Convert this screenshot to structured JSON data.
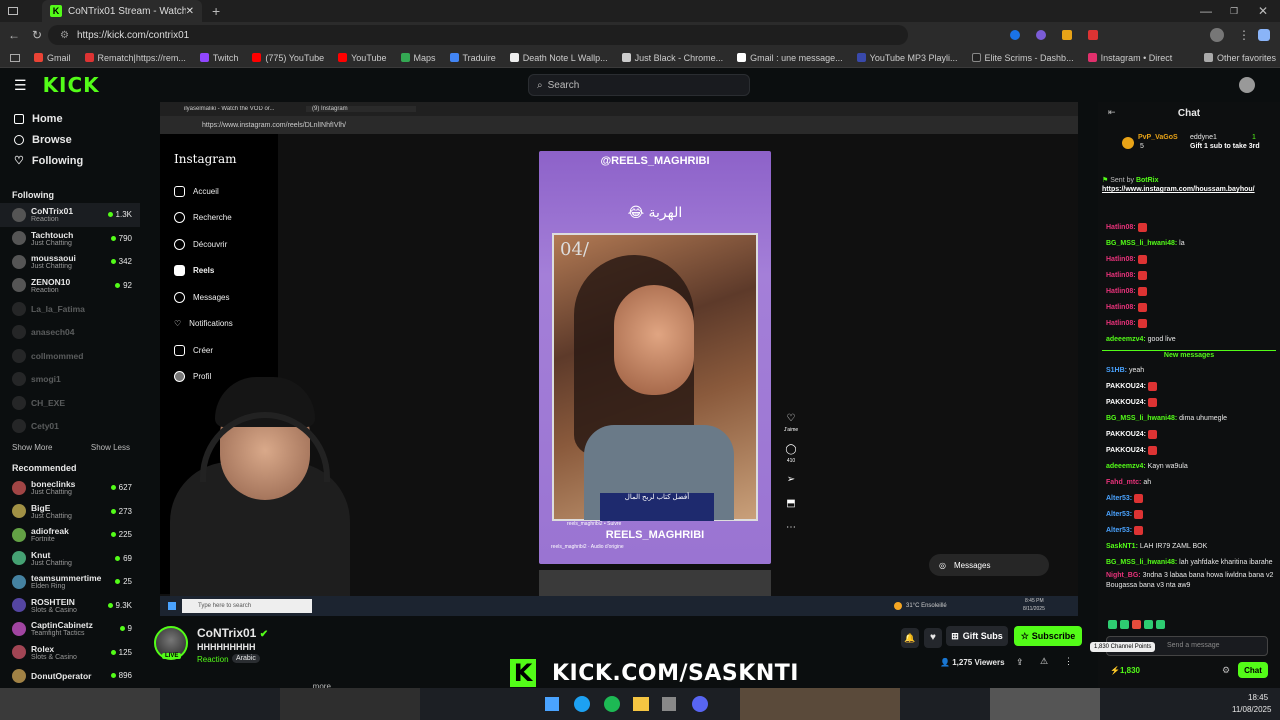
{
  "browser": {
    "tab_title": "CoNTrix01 Stream - Watch l...",
    "url": "https://kick.com/contrix01",
    "bookmarks": [
      "Gmail",
      "Rematch|https://rem...",
      "Twitch",
      "(775) YouTube",
      "YouTube",
      "Maps",
      "Traduire",
      "Death Note L Wallp...",
      "Just Black - Chrome...",
      "Gmail : une message...",
      "YouTube MP3 Playli...",
      "Elite Scrims - Dashb...",
      "Instagram • Direct"
    ],
    "other_favorites": "Other favorites"
  },
  "kick": {
    "logo": "KICK",
    "search_placeholder": "Search"
  },
  "sidebar": {
    "nav": [
      {
        "label": "Home",
        "icon": "home-icon"
      },
      {
        "label": "Browse",
        "icon": "browse-icon"
      },
      {
        "label": "Following",
        "icon": "heart-icon"
      }
    ],
    "following_title": "Following",
    "following": [
      {
        "name": "CoNTrix01",
        "cat": "Reaction",
        "viewers": "1.3K",
        "live": true
      },
      {
        "name": "Tachtouch",
        "cat": "Just Chatting",
        "viewers": "790",
        "live": true
      },
      {
        "name": "moussaoui",
        "cat": "Just Chatting",
        "viewers": "342",
        "live": true
      },
      {
        "name": "ZENON10",
        "cat": "Reaction",
        "viewers": "92",
        "live": true
      },
      {
        "name": "La_la_Fatima",
        "cat": "",
        "viewers": "",
        "live": false
      },
      {
        "name": "anasech04",
        "cat": "",
        "viewers": "",
        "live": false
      },
      {
        "name": "collmommed",
        "cat": "",
        "viewers": "",
        "live": false
      },
      {
        "name": "smogi1",
        "cat": "",
        "viewers": "",
        "live": false
      },
      {
        "name": "CH_EXE",
        "cat": "",
        "viewers": "",
        "live": false
      },
      {
        "name": "Cety01",
        "cat": "",
        "viewers": "",
        "live": false
      }
    ],
    "show_more": "Show More",
    "show_less": "Show Less",
    "recommended_title": "Recommended",
    "recommended": [
      {
        "name": "boneclinks",
        "cat": "Just Chatting",
        "viewers": "627"
      },
      {
        "name": "BigE",
        "cat": "Just Chatting",
        "viewers": "273"
      },
      {
        "name": "adiofreak",
        "cat": "Fortnite",
        "viewers": "225"
      },
      {
        "name": "Knut",
        "cat": "Just Chatting",
        "viewers": "69"
      },
      {
        "name": "teamsummertime",
        "cat": "Elden Ring",
        "viewers": "25"
      },
      {
        "name": "ROSHTEIN",
        "cat": "Slots & Casino",
        "viewers": "9.3K"
      },
      {
        "name": "CaptinCabinetz",
        "cat": "Teamfight Tactics",
        "viewers": "9"
      },
      {
        "name": "Rolex",
        "cat": "Slots & Casino",
        "viewers": "125"
      },
      {
        "name": "DonutOperator",
        "cat": "",
        "viewers": "896"
      }
    ]
  },
  "video": {
    "inner_tab1": "ilyaselmaliki - Watch the VOD or...",
    "inner_tab2": "(9) Instagram",
    "inner_url": "https://www.instagram.com/reels/DLnlINhfIVlh/",
    "ig_logo": "Instagram",
    "ig_nav": [
      "Accueil",
      "Recherche",
      "Découvrir",
      "Reels",
      "Messages",
      "Notifications",
      "Créer",
      "Profil"
    ],
    "reel_handle": "@REELS_MAGHRIBI",
    "reel_caption": "الهربة 😂",
    "reel_counter": "04/",
    "reel_footer": "REELS_MAGHRIBI",
    "reel_ad": "أفضل كتاب لربح المال",
    "reel_user": "reels_maghribi2 • Suivre",
    "reel_audio": "reels_maghribi2 · Audio d'origine",
    "likes_label": "J'aime",
    "comments_count": "410",
    "messages_label": "Messages",
    "task_search": "Type here to search",
    "weather": "31°C  Ensoleillé",
    "clock_time": "8:45 PM",
    "clock_date": "8/11/2025"
  },
  "stream": {
    "name": "CoNTrix01",
    "title": "HHHHHHHHH",
    "category": "Reaction",
    "language": "Arabic",
    "live_badge": "LIVE",
    "viewers": "1,275 Viewers",
    "gift_subs": "Gift Subs",
    "subscribe": "Subscribe",
    "more": "...more",
    "banner": "KICK.COM/SASKNTI"
  },
  "chat": {
    "title": "Chat",
    "pinned_user1": "PvP_VaGoS",
    "pinned_count": "5",
    "pinned_user2": "eddyne1",
    "pinned_gift_count": "1",
    "pinned_text": "Gift 1 sub to take 3rd",
    "sent_by": "Sent by",
    "sent_by_name": "BotRix",
    "pinned_link": "https://www.instagram.com/houssam.bayhou/",
    "new_messages": "New messages",
    "messages": [
      {
        "user": "Hatlin08:",
        "text": "",
        "color": "#e8327a"
      },
      {
        "user": "BG_MSS_li_hwani48:",
        "text": "la",
        "color": "#53fc18"
      },
      {
        "user": "Hatlin08:",
        "text": "",
        "color": "#e8327a"
      },
      {
        "user": "Hatlin08:",
        "text": "",
        "color": "#e8327a"
      },
      {
        "user": "Hatlin08:",
        "text": "",
        "color": "#e8327a"
      },
      {
        "user": "Hatlin08:",
        "text": "",
        "color": "#e8327a"
      },
      {
        "user": "Hatlin08:",
        "text": "",
        "color": "#e8327a"
      },
      {
        "user": "adeeemzv4:",
        "text": "good live",
        "color": "#53fc18"
      },
      {
        "user": "S1HB:",
        "text": "yeah",
        "color": "#4aa3ff"
      },
      {
        "user": "PAKKOU24:",
        "text": "",
        "color": "#ffffff"
      },
      {
        "user": "PAKKOU24:",
        "text": "",
        "color": "#ffffff"
      },
      {
        "user": "BG_MSS_li_hwani48:",
        "text": "dima uhumegle",
        "color": "#53fc18"
      },
      {
        "user": "PAKKOU24:",
        "text": "",
        "color": "#ffffff"
      },
      {
        "user": "PAKKOU24:",
        "text": "",
        "color": "#ffffff"
      },
      {
        "user": "adeeemzv4:",
        "text": "Kayn wa9ula",
        "color": "#53fc18"
      },
      {
        "user": "Fahd_mtc:",
        "text": "ah",
        "color": "#e8327a"
      },
      {
        "user": "Alter53:",
        "text": "",
        "color": "#4aa3ff"
      },
      {
        "user": "Alter53:",
        "text": "",
        "color": "#4aa3ff"
      },
      {
        "user": "Alter53:",
        "text": "",
        "color": "#4aa3ff"
      },
      {
        "user": "SaskNT1:",
        "text": "LAH IR79 ZAML BOK",
        "color": "#53fc18"
      },
      {
        "user": "BG_MSS_li_hwani48:",
        "text": "lah yahfdake kharitina ibarahe",
        "color": "#53fc18"
      },
      {
        "user": "Night_BG:",
        "text": "3ndna 3 labaa bana howa liwldna bana v2 Bougassa bana v3 nta aw9",
        "color": "#e8327a"
      }
    ],
    "channel_points_tip": "1,830 Channel Points",
    "send_placeholder": "Send a message",
    "points": "1,830",
    "send": "Chat"
  },
  "taskbar": {
    "time": "18:45",
    "date": "11/08/2025"
  },
  "colors": {
    "accent": "#53fc18",
    "bg": "#0b0e0f"
  }
}
